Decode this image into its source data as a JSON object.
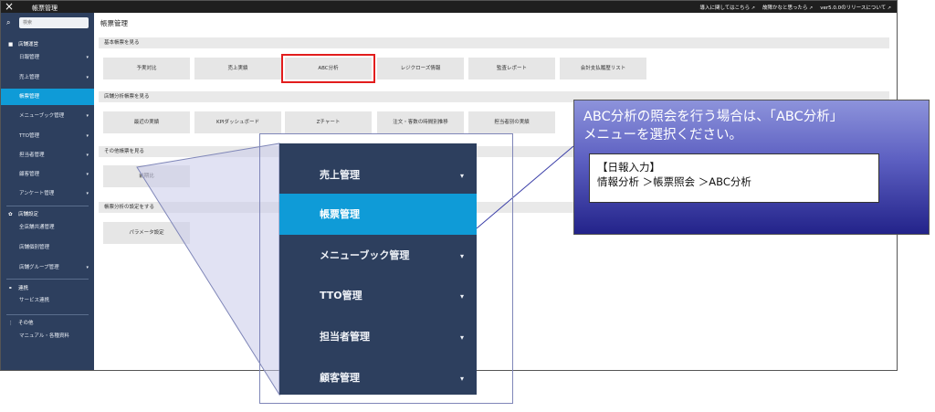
{
  "topbar": {
    "close_icon": "×",
    "app_title": "帳票管理",
    "links": [
      "導入に関してはこちら",
      "故障かなと思ったら",
      "ver5.0.0のリリースについて"
    ]
  },
  "sidebar": {
    "search_placeholder": "検索",
    "sections": [
      {
        "icon": "■",
        "label": "店舗運営"
      },
      {
        "icon": "✿",
        "label": "店舗設定"
      },
      {
        "icon": "⚭",
        "label": "連携"
      },
      {
        "icon": "⋮",
        "label": "その他"
      }
    ],
    "items": [
      {
        "label": "日報管理",
        "chev": "▾"
      },
      {
        "label": "売上管理",
        "chev": "▾"
      },
      {
        "label": "帳票管理",
        "chev": ""
      },
      {
        "label": "メニューブック管理",
        "chev": "▾"
      },
      {
        "label": "TTO管理",
        "chev": "▾"
      },
      {
        "label": "担当者管理",
        "chev": "▾"
      },
      {
        "label": "顧客管理",
        "chev": "▾"
      },
      {
        "label": "アンケート管理",
        "chev": "▾"
      },
      {
        "label": "全店舗共通管理",
        "chev": ""
      },
      {
        "label": "店舗個別管理",
        "chev": ""
      },
      {
        "label": "店舗グループ管理",
        "chev": "▾"
      },
      {
        "label": "サービス連携",
        "chev": ""
      },
      {
        "label": "マニュアル・各種資料",
        "chev": ""
      }
    ]
  },
  "main": {
    "title": "帳票管理",
    "sections": [
      {
        "title": "基本帳票を見る",
        "tiles": [
          "予実対比",
          "売上実績",
          "ABC分析",
          "レジクローズ情報",
          "監査レポート",
          "会計支払履歴リスト"
        ]
      },
      {
        "title": "店舗分析帳票を見る",
        "tiles": [
          "最近の実績",
          "KPIダッシュボード",
          "Zチャート",
          "注文・客数の時間別推移",
          "担当者別の実績"
        ]
      },
      {
        "title": "その他帳票を見る",
        "tiles": [
          "前期比"
        ]
      },
      {
        "title": "帳票分析の設定をする",
        "tiles": [
          "パラメータ設定"
        ]
      }
    ]
  },
  "zoom_menu": {
    "items": [
      {
        "label": "売上管理",
        "chev": "▾"
      },
      {
        "label": "帳票管理",
        "chev": ""
      },
      {
        "label": "メニューブック管理",
        "chev": "▾"
      },
      {
        "label": "TTO管理",
        "chev": "▾"
      },
      {
        "label": "担当者管理",
        "chev": "▾"
      },
      {
        "label": "顧客管理",
        "chev": "▾"
      }
    ]
  },
  "info_callout": {
    "line1": "ABC分析の照会を行う場合は、「ABC分析」",
    "line2": "メニューを選択ください。",
    "box_line1": "【日報入力】",
    "box_line2": "情報分析 ＞帳票照会 ＞ABC分析"
  },
  "colors": {
    "sidebar_bg": "#2d3f5e",
    "active_blue": "#0f9bd7",
    "highlight_red": "#e21d1d",
    "callout_purple": "#5c5fc1"
  }
}
